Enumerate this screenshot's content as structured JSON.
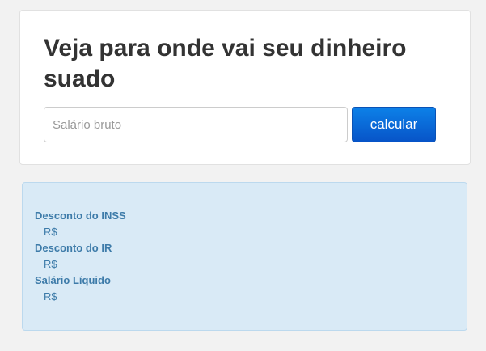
{
  "header": {
    "title": "Veja para onde vai seu dinheiro suado"
  },
  "form": {
    "salary_placeholder": "Salário bruto",
    "salary_value": "",
    "calculate_label": "calcular"
  },
  "results": {
    "items": [
      {
        "label": "Desconto do INSS",
        "value": "R$"
      },
      {
        "label": "Desconto do IR",
        "value": "R$"
      },
      {
        "label": "Salário Líquido",
        "value": "R$"
      }
    ]
  },
  "colors": {
    "page_background": "#f2f2f2",
    "card_background": "#ffffff",
    "button_primary": "#0b6fdc",
    "results_background": "#d9eaf6",
    "results_text": "#3d7ba9"
  }
}
